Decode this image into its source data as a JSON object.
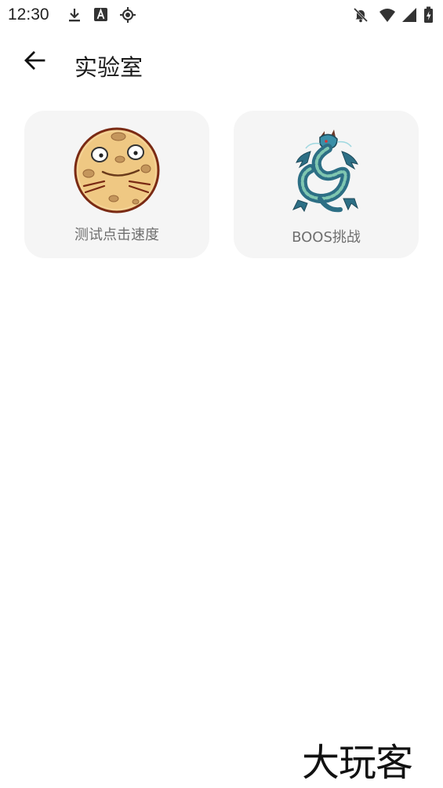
{
  "status_bar": {
    "time": "12:30",
    "left_icons": [
      "download-icon",
      "text-a-icon",
      "location-target-icon"
    ],
    "right_icons": [
      "notifications-off-icon",
      "wifi-icon",
      "cellular-signal-icon",
      "battery-charging-icon"
    ]
  },
  "top_bar": {
    "back_icon": "arrow-left-icon",
    "title": "实验室"
  },
  "cards": [
    {
      "label": "测试点击速度",
      "icon": "cookie-face-icon"
    },
    {
      "label": "BOOS挑战",
      "icon": "dragon-icon"
    }
  ],
  "watermark": "大玩客",
  "colors": {
    "background": "#ffffff",
    "card_background": "#f5f5f5",
    "label_text": "#6f6f6f",
    "cookie_fill": "#efc883",
    "cookie_outline": "#7a2a14",
    "dragon_teal": "#3a8fa8"
  }
}
